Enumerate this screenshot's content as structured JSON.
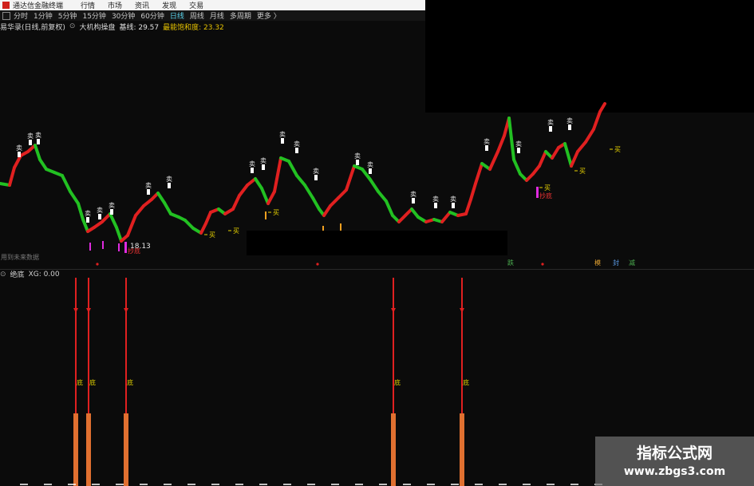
{
  "app": {
    "title": "通达信金融终端",
    "menu": [
      "行情",
      "市场",
      "资讯",
      "发现",
      "交易"
    ]
  },
  "periods": [
    "分时",
    "1分钟",
    "5分钟",
    "15分钟",
    "30分钟",
    "60分钟",
    "日线",
    "周线",
    "月线",
    "多周期",
    "更多 〉"
  ],
  "active_period": "日线",
  "main_indicator": {
    "name": "易华录(日线,前复权)",
    "formula": "大机构操盘",
    "base_label": "基线: 29.57",
    "strength_label": "最能饱和度: 23.32",
    "low_price": "18.13",
    "future_label": "用到未来数据"
  },
  "sub_indicator": {
    "name": "绝底",
    "value": "XG: 0.00"
  },
  "signals": {
    "sell": "卖",
    "buy": "买",
    "buy_low": "抄底",
    "bottom": "底"
  },
  "bottom_tags": [
    "跌",
    "模",
    "封",
    "减"
  ],
  "watermark": {
    "title": "指标公式网",
    "url": "www.zbgs3.com"
  },
  "colors": {
    "up": "#e02020",
    "down": "#22c022",
    "bottom_bar": "#e07030",
    "active_tab": "#5bd1e8"
  }
}
